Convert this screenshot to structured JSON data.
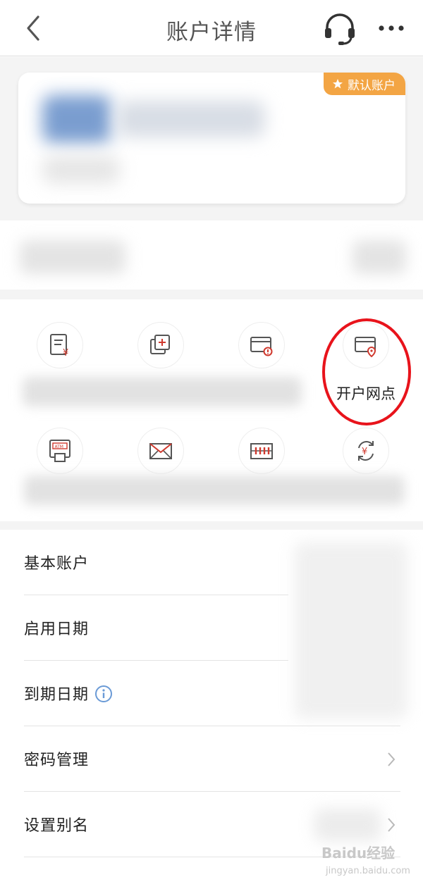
{
  "header": {
    "title": "账户详情",
    "back_icon": "chevron-left-icon",
    "service_icon": "headset-icon",
    "more_icon": "more-dots-icon"
  },
  "card": {
    "badge_label": "默认账户",
    "badge_icon": "star-icon",
    "badge_color": "#f3a544"
  },
  "quick_actions": {
    "items": [
      {
        "icon": "bill-yuan-icon",
        "label": ""
      },
      {
        "icon": "add-card-icon",
        "label": ""
      },
      {
        "icon": "card-alert-icon",
        "label": ""
      },
      {
        "icon": "card-location-icon",
        "label": "开户网点"
      },
      {
        "icon": "atm-icon",
        "label": ""
      },
      {
        "icon": "envelope-icon",
        "label": ""
      },
      {
        "icon": "abacus-icon",
        "label": ""
      },
      {
        "icon": "yuan-exchange-icon",
        "label": ""
      }
    ],
    "highlight_color": "#e8131b"
  },
  "details": {
    "rows": [
      {
        "label": "基本账户"
      },
      {
        "label": "启用日期"
      },
      {
        "label": "到期日期",
        "icon": "info-icon"
      },
      {
        "label": "密码管理",
        "icon": "chevron-right-icon"
      },
      {
        "label": "设置别名",
        "icon": "chevron-right-icon"
      }
    ]
  },
  "watermark": {
    "text": "Baidu经验",
    "sub": "jingyan.baidu.com"
  }
}
